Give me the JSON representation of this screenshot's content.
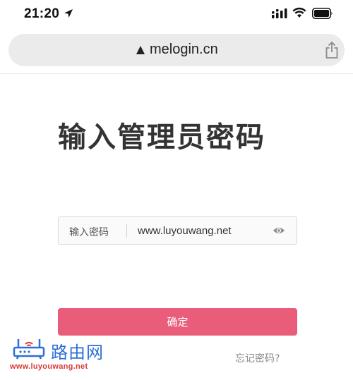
{
  "status_bar": {
    "time": "21:20",
    "icons": [
      "location-arrow-icon",
      "cellular-signal-icon",
      "wifi-icon",
      "battery-icon"
    ]
  },
  "browser": {
    "url": "melogin.cn",
    "lock_icon": "lock-icon",
    "share_icon": "share-icon"
  },
  "page": {
    "title": "输入管理员密码",
    "password_label": "输入密码",
    "password_value": "www.luyouwang.net",
    "confirm_label": "确定",
    "forgot_label": "忘记密码?"
  },
  "watermark": {
    "name": "路由网",
    "url": "www.luyouwang.net"
  },
  "colors": {
    "primary_button": "#e95d7a",
    "address_bar": "#ebebec",
    "watermark_blue": "#2d6fd6",
    "watermark_red": "#d83a3a"
  }
}
